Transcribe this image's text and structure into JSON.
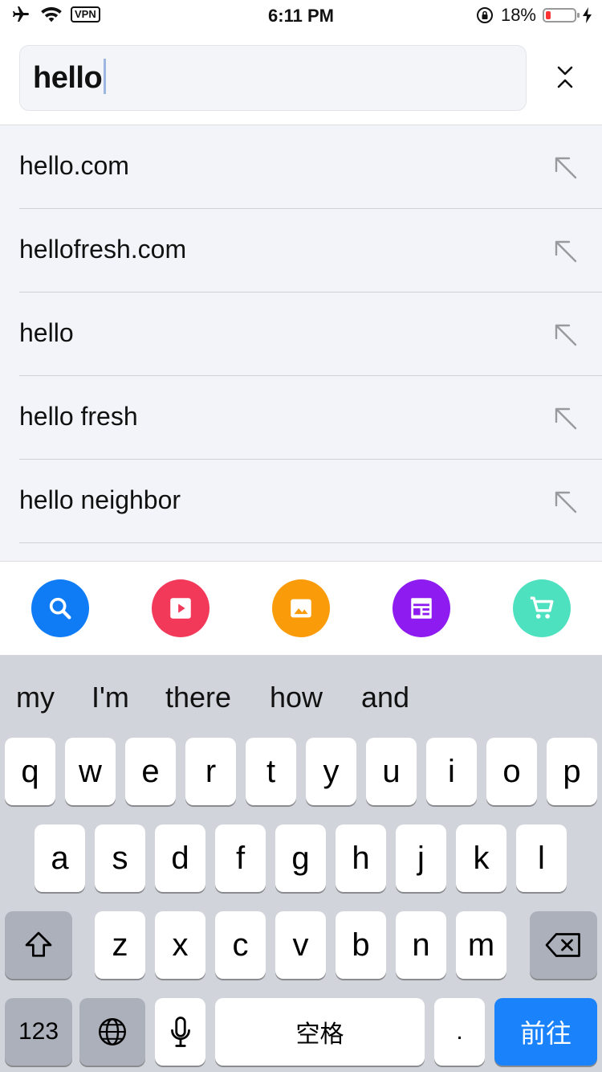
{
  "status_bar": {
    "time": "6:11 PM",
    "vpn": "VPN",
    "battery_percent": "18%",
    "battery_level": 0.18
  },
  "search": {
    "query": "hello"
  },
  "suggestions": [
    {
      "text": "hello.com"
    },
    {
      "text": "hellofresh.com"
    },
    {
      "text": "hello"
    },
    {
      "text": "hello fresh"
    },
    {
      "text": "hello neighbor"
    }
  ],
  "categories": [
    {
      "name": "search-category-icon",
      "color": "#0f7cf5"
    },
    {
      "name": "video-category-icon",
      "color": "#f2395a"
    },
    {
      "name": "image-category-icon",
      "color": "#fa9b0a"
    },
    {
      "name": "news-category-icon",
      "color": "#8e1bef"
    },
    {
      "name": "shopping-category-icon",
      "color": "#4ee1c0"
    }
  ],
  "keyboard": {
    "predictions": [
      "my",
      "I'm",
      "there",
      "how",
      "and"
    ],
    "row1": [
      "q",
      "w",
      "e",
      "r",
      "t",
      "y",
      "u",
      "i",
      "o",
      "p"
    ],
    "row2": [
      "a",
      "s",
      "d",
      "f",
      "g",
      "h",
      "j",
      "k",
      "l"
    ],
    "row3": [
      "z",
      "x",
      "c",
      "v",
      "b",
      "n",
      "m"
    ],
    "numbers_label": "123",
    "space_label": "空格",
    "period_label": ".",
    "go_label": "前往"
  }
}
